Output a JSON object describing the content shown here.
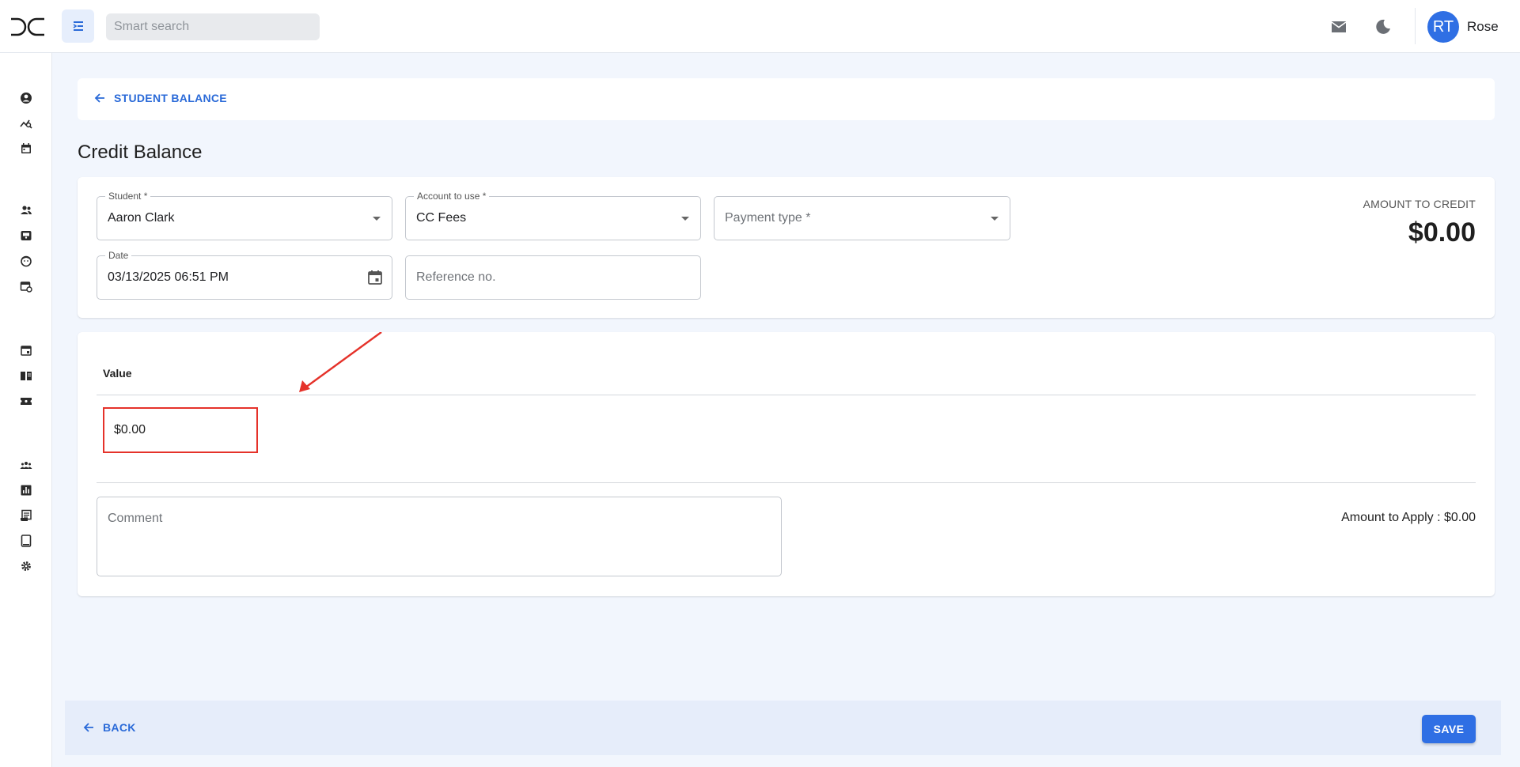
{
  "header": {
    "logo_icon": "dc-logo",
    "menu_icon": "collapse-menu-icon",
    "search_placeholder": "Smart search",
    "mail_icon": "mail-icon",
    "theme_icon": "moon-icon",
    "user": {
      "initials": "RT",
      "name": "Rose",
      "avatar_color": "#2f6fe4"
    }
  },
  "sidebar": {
    "icons": [
      "account-circle-icon",
      "analytics-icon",
      "calendar-icon",
      "people-icon",
      "inbox-icon",
      "face-icon",
      "event-repeat-icon",
      "event-icon",
      "book-icon",
      "ticket-icon",
      "groups-icon",
      "chart-icon",
      "receipt-icon",
      "tablet-icon",
      "gear-icon"
    ]
  },
  "breadcrumb": {
    "label": "STUDENT BALANCE"
  },
  "page": {
    "title": "Credit Balance"
  },
  "form": {
    "student": {
      "label": "Student *",
      "value": "Aaron Clark"
    },
    "account": {
      "label": "Account to use *",
      "value": "CC Fees"
    },
    "payment_type": {
      "placeholder": "Payment type *"
    },
    "date": {
      "label": "Date",
      "value": "03/13/2025 06:51 PM"
    },
    "reference": {
      "placeholder": "Reference no."
    },
    "amount_to_credit": {
      "label": "AMOUNT TO CREDIT",
      "value": "$0.00"
    }
  },
  "values_table": {
    "column_header": "Value",
    "rows": [
      {
        "value": "$0.00"
      }
    ]
  },
  "comment": {
    "placeholder": "Comment"
  },
  "amount_to_apply": "Amount to Apply : $0.00",
  "footer": {
    "back_label": "BACK",
    "save_label": "SAVE"
  },
  "colors": {
    "accent": "#2f6fe4",
    "link": "#2a6ad8",
    "highlight": "#e5322a",
    "background": "#f2f6fd"
  }
}
